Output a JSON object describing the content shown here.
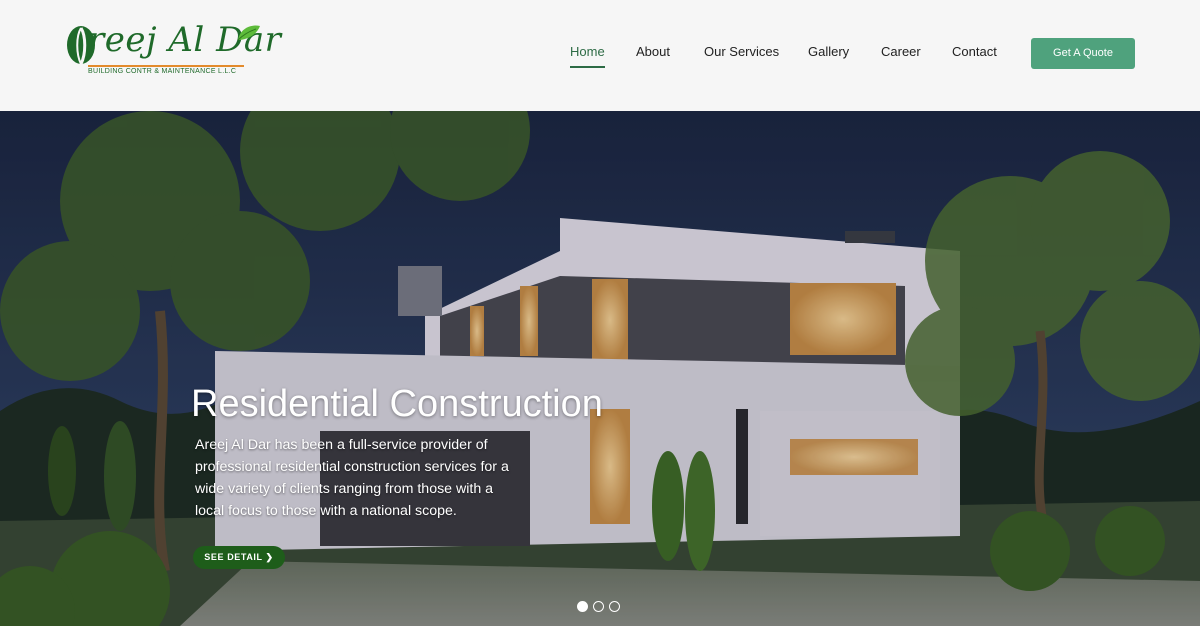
{
  "brand": {
    "name": "reej Al Dar",
    "subtitle": "BUILDING CONTR & MAINTENANCE L.L.C",
    "color": "#1f6a2a",
    "accent": "#e38b2c"
  },
  "nav": {
    "items": [
      {
        "label": "Home",
        "active": true
      },
      {
        "label": "About",
        "active": false
      },
      {
        "label": "Our Services",
        "active": false
      },
      {
        "label": "Gallery",
        "active": false
      },
      {
        "label": "Career",
        "active": false
      },
      {
        "label": "Contact",
        "active": false
      }
    ],
    "cta_label": "Get A Quote",
    "cta_color": "#4fa27d",
    "active_color": "#2d6b45"
  },
  "hero": {
    "title": "Residential Construction",
    "description": "Areej Al Dar has been a full-service provider of professional residential construction services for a wide variety of clients ranging from those with a local focus to those with a national scope.",
    "button_label": "SEE DETAIL ❯",
    "button_color": "#1e5d1a",
    "slides": [
      {
        "active": true
      },
      {
        "active": false
      },
      {
        "active": false
      }
    ]
  }
}
